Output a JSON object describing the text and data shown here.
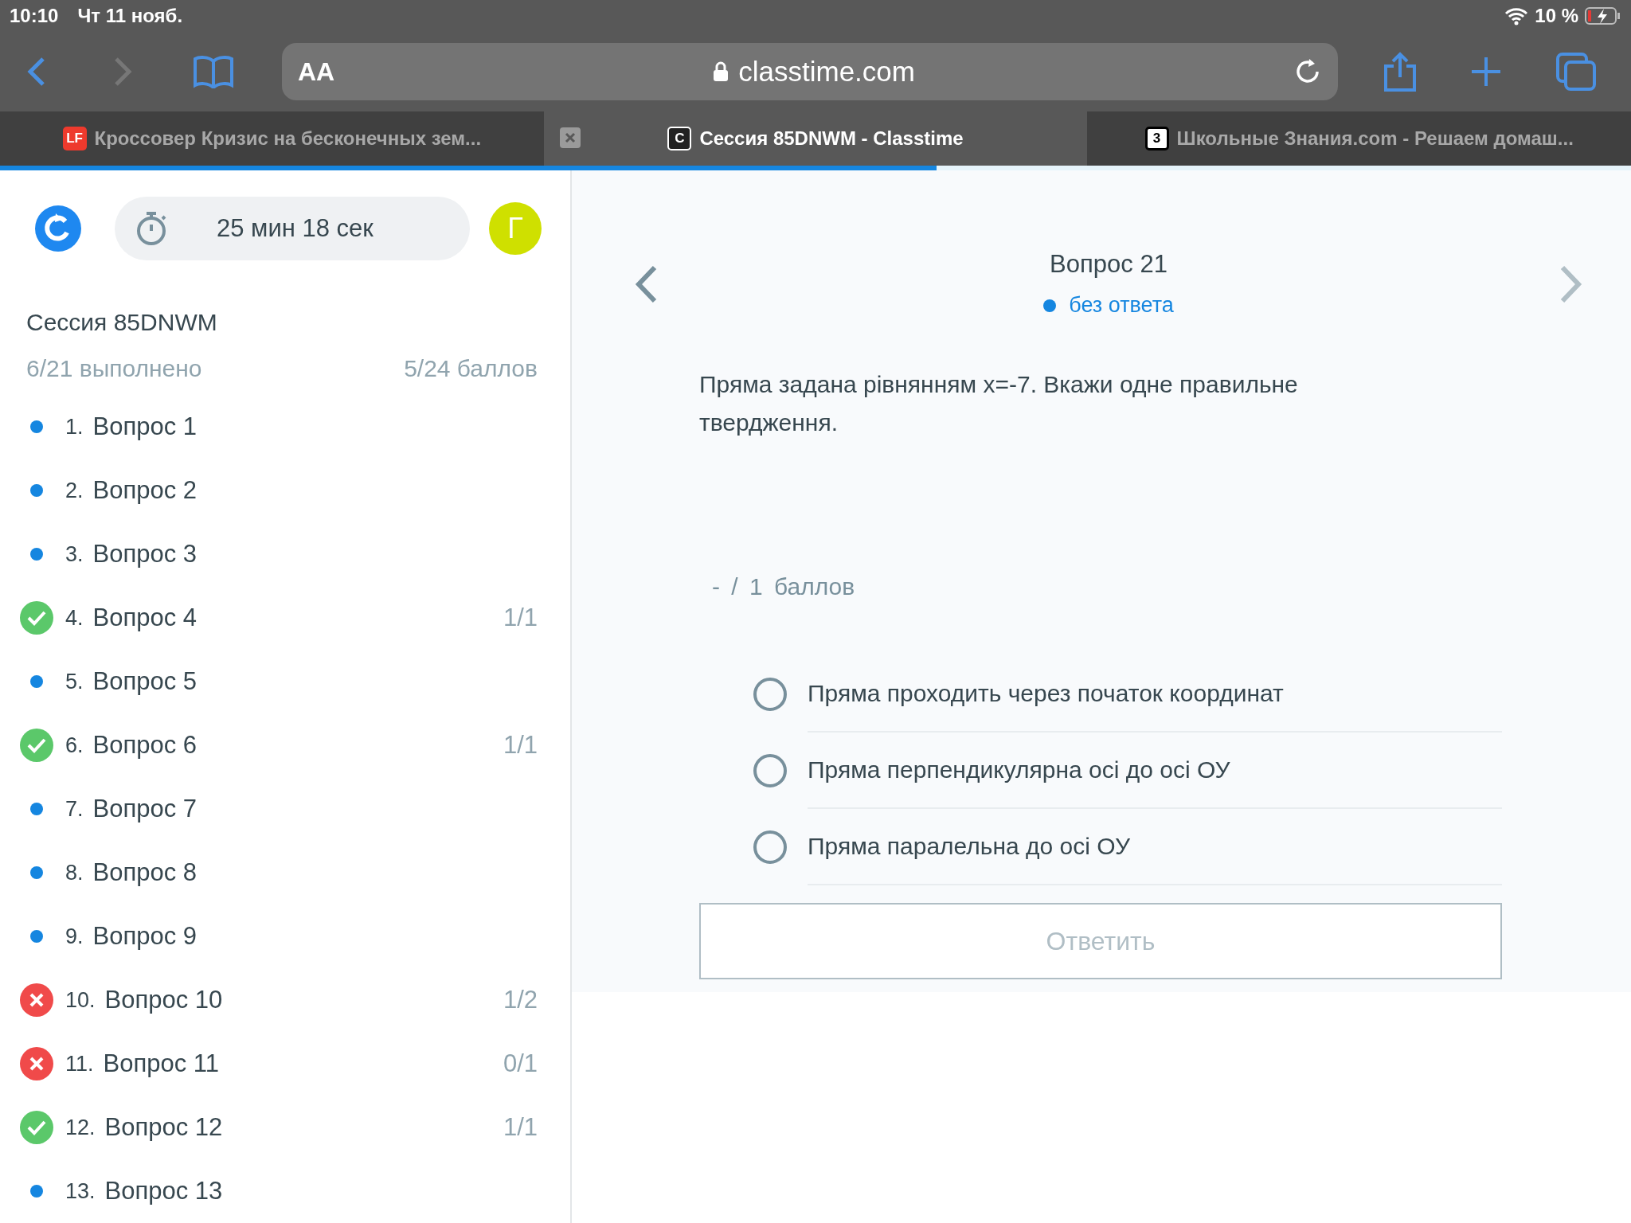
{
  "status_bar": {
    "time": "10:10",
    "date": "Чт 11 нояб.",
    "battery": "10 %"
  },
  "toolbar": {
    "text_size": "AA",
    "url": "classtime.com"
  },
  "tabs": [
    {
      "title": "Кроссовер Кризис на бесконечных зем...",
      "favicon": "LF",
      "selected": false,
      "closable": false
    },
    {
      "title": "Сессия 85DNWM - Classtime",
      "favicon": "C",
      "selected": true,
      "closable": true
    },
    {
      "title": "Школьные Знания.com - Решаем домаш...",
      "favicon": "3",
      "selected": false,
      "closable": false
    }
  ],
  "page_load": {
    "level": 0.574
  },
  "sidebar": {
    "timer": "25 мин 18 сек",
    "avatar": "Г",
    "session_title": "Сессия 85DNWM",
    "completed": "6/21 выполнено",
    "score": "5/24 баллов",
    "questions": [
      {
        "number": "1.",
        "label": "Вопрос 1",
        "kind": "unanswered"
      },
      {
        "number": "2.",
        "label": "Вопрос 2",
        "kind": "unanswered"
      },
      {
        "number": "3.",
        "label": "Вопрос 3",
        "kind": "unanswered"
      },
      {
        "number": "4.",
        "label": "Вопрос 4",
        "kind": "correct",
        "points": "1/1"
      },
      {
        "number": "5.",
        "label": "Вопрос 5",
        "kind": "unanswered"
      },
      {
        "number": "6.",
        "label": "Вопрос 6",
        "kind": "correct",
        "points": "1/1"
      },
      {
        "number": "7.",
        "label": "Вопрос 7",
        "kind": "unanswered"
      },
      {
        "number": "8.",
        "label": "Вопрос 8",
        "kind": "unanswered"
      },
      {
        "number": "9.",
        "label": "Вопрос 9",
        "kind": "unanswered"
      },
      {
        "number": "10.",
        "label": "Вопрос 10",
        "kind": "wrong",
        "points": "1/2"
      },
      {
        "number": "11.",
        "label": "Вопрос 11",
        "kind": "wrong",
        "points": "0/1"
      },
      {
        "number": "12.",
        "label": "Вопрос 12",
        "kind": "correct",
        "points": "1/1"
      },
      {
        "number": "13.",
        "label": "Вопрос 13",
        "kind": "unanswered"
      }
    ]
  },
  "question": {
    "title": "Вопрос 21",
    "status": "без ответа",
    "text": "Пряма задана рівнянням x=-7. Вкажи одне правильне твердження.",
    "points": "- / 1 баллов",
    "options": [
      {
        "label": "Пряма проходить через початок координат",
        "selected": false
      },
      {
        "label": "Пряма перпендикулярна осі до осі ОУ",
        "selected": false
      },
      {
        "label": "Пряма паралельна до осі ОУ",
        "selected": false
      }
    ],
    "submit": "Ответить"
  }
}
